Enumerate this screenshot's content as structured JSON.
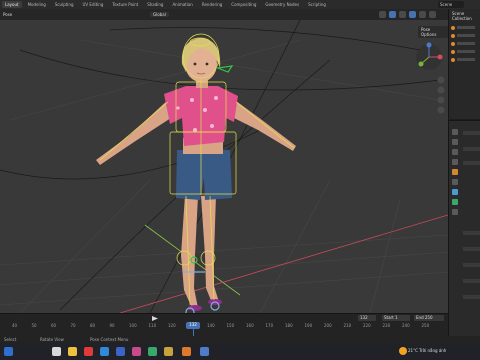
{
  "menu": {
    "tabs": [
      "Layout",
      "Modeling",
      "Sculpting",
      "UV Editing",
      "Texture Paint",
      "Shading",
      "Animation",
      "Rendering",
      "Compositing",
      "Geometry Nodes",
      "Scripting"
    ],
    "scene_label": "Scene"
  },
  "viewport": {
    "mode_label": "Pose",
    "orientation_label": "Global",
    "options_label": "Pose Options"
  },
  "outliner": {
    "title": "Scene Collection"
  },
  "timeline": {
    "current_frame": "132",
    "start_label": "Start",
    "start_value": "1",
    "end_label": "End",
    "end_value": "250",
    "ticks": [
      "40",
      "50",
      "60",
      "70",
      "80",
      "90",
      "100",
      "110",
      "120",
      "130",
      "140",
      "150",
      "160",
      "170",
      "180",
      "190",
      "200",
      "210",
      "220",
      "230",
      "240",
      "250"
    ]
  },
  "statusbar": {
    "left": "Select",
    "middle": "Rotate View",
    "right": "Pose Context Menu"
  },
  "taskbar": {
    "weather": "21°C  Trời nắng ánh"
  },
  "colors": {
    "accent": "#4772b3",
    "viewport_bg": "#393939",
    "armature": "#e6e04a",
    "shirt": "#e0508a",
    "shorts": "#3a5a86"
  }
}
